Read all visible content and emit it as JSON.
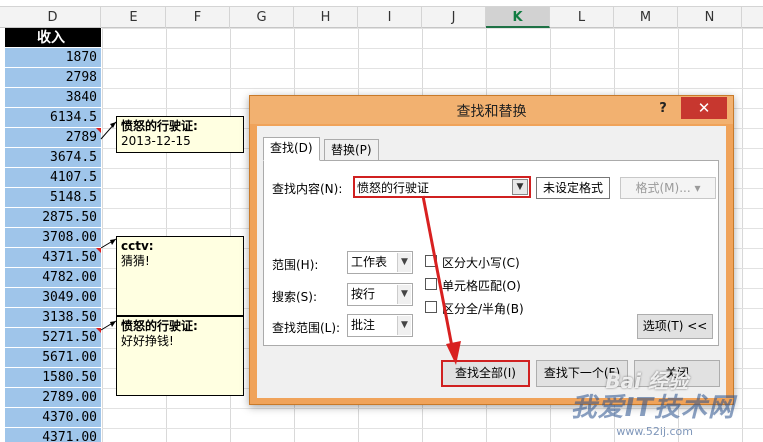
{
  "sheet": {
    "columns": [
      "D",
      "E",
      "F",
      "G",
      "H",
      "I",
      "J",
      "K",
      "L",
      "M",
      "N"
    ],
    "active_column": "K",
    "header_cell": "收入",
    "values": [
      "1870",
      "2798",
      "3840",
      "6134.5",
      "2789",
      "3674.5",
      "4107.5",
      "5148.5",
      "2875.50",
      "3708.00",
      "4371.50",
      "4782.00",
      "3049.00",
      "3138.50",
      "5271.50",
      "5671.00",
      "1580.50",
      "2789.00",
      "4370.00",
      "4371.00"
    ]
  },
  "comments": [
    {
      "author": "愤怒的行驶证:",
      "text": "2013-12-15"
    },
    {
      "author": "cctv:",
      "text": "猜猜!"
    },
    {
      "author": "愤怒的行驶证:",
      "text": "好好挣钱!"
    }
  ],
  "dialog": {
    "title": "查找和替换",
    "help": "?",
    "close": "✕",
    "tabs": [
      {
        "label": "查找(D)",
        "active": true
      },
      {
        "label": "替换(P)",
        "active": false
      }
    ],
    "find_label": "查找内容(N):",
    "find_value": "愤怒的行驶证",
    "format_preview": "未设定格式",
    "format_button": "格式(M)... ▾",
    "scope_label": "范围(H):",
    "scope_value": "工作表",
    "search_label": "搜索(S):",
    "search_value": "按行",
    "lookin_label": "查找范围(L):",
    "lookin_value": "批注",
    "match_case": "区分大小写(C)",
    "match_cell": "单元格匹配(O)",
    "match_width": "区分全/半角(B)",
    "options_button": "选项(T) <<",
    "find_all_button": "查找全部(I)",
    "find_next_button": "查找下一个(F)",
    "close_button": "关闭"
  },
  "watermark": {
    "brand": "Bai 经验",
    "main": "我爱IT技术网",
    "site": "www.52ij.com"
  },
  "colors": {
    "dialog_frame": "#f0a35a",
    "highlight_red": "#d02020",
    "data_column": "#9fc5ea",
    "comment_bg": "#ffffe1"
  }
}
